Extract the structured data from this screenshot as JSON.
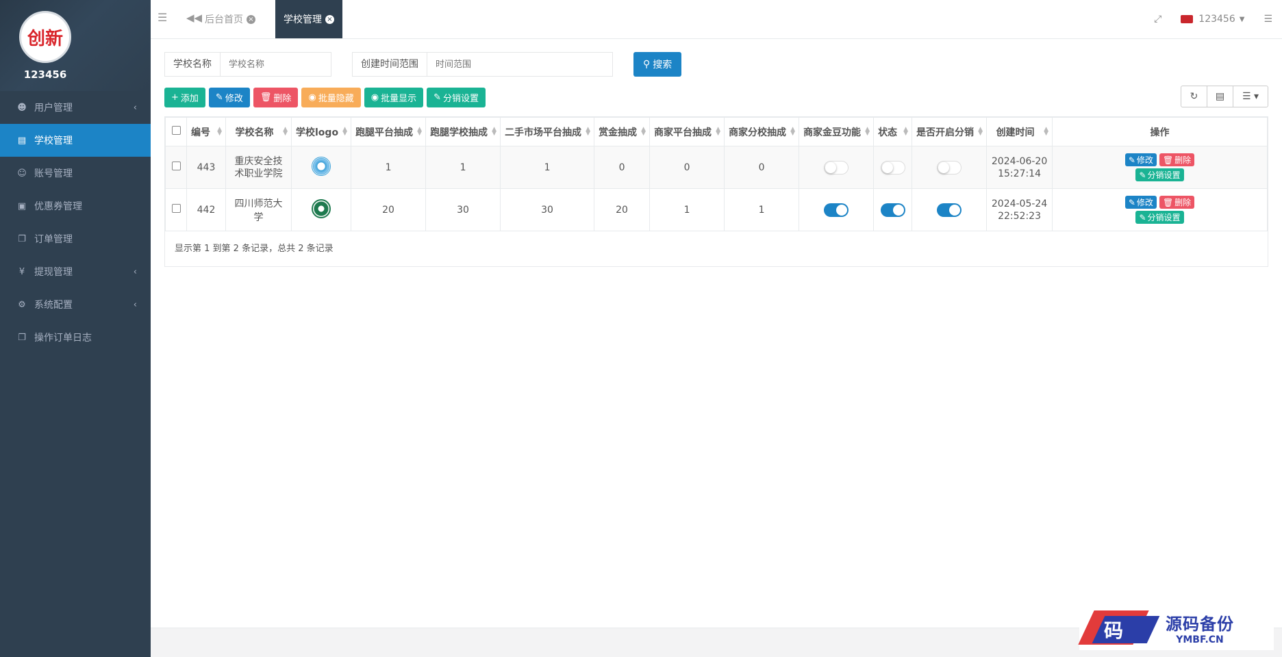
{
  "profile": {
    "name": "123456",
    "logo_text": "创新"
  },
  "sidebar": {
    "items": [
      {
        "label": "用户管理",
        "icon": "user-icon",
        "has_arrow": true,
        "active": false
      },
      {
        "label": "学校管理",
        "icon": "file-icon",
        "has_arrow": false,
        "active": true
      },
      {
        "label": "账号管理",
        "icon": "users-icon",
        "has_arrow": false,
        "active": false
      },
      {
        "label": "优惠券管理",
        "icon": "money-icon",
        "has_arrow": false,
        "active": false
      },
      {
        "label": "订单管理",
        "icon": "copy-icon",
        "has_arrow": false,
        "active": false
      },
      {
        "label": "提现管理",
        "icon": "yen-icon",
        "has_arrow": true,
        "active": false
      },
      {
        "label": "系统配置",
        "icon": "gear-icon",
        "has_arrow": true,
        "active": false
      },
      {
        "label": "操作订单日志",
        "icon": "copy-icon",
        "has_arrow": false,
        "active": false
      }
    ]
  },
  "topbar": {
    "tabs": [
      {
        "label": "后台首页",
        "active": false
      },
      {
        "label": "学校管理",
        "active": true
      }
    ],
    "user": "123456"
  },
  "search": {
    "school_label": "学校名称",
    "school_placeholder": "学校名称",
    "time_label": "创建时间范围",
    "time_placeholder": "时间范围",
    "button": "搜索"
  },
  "toolbar": {
    "add": "添加",
    "edit": "修改",
    "delete": "删除",
    "batch_hide": "批量隐藏",
    "batch_show": "批量显示",
    "distribution": "分销设置"
  },
  "table": {
    "headers": [
      "编号",
      "学校名称",
      "学校logo",
      "跑腿平台抽成",
      "跑腿学校抽成",
      "二手市场平台抽成",
      "赏金抽成",
      "商家平台抽成",
      "商家分校抽成",
      "商家金豆功能",
      "状态",
      "是否开启分销",
      "创建时间",
      "操作"
    ],
    "rows": [
      {
        "id": "443",
        "name": "重庆安全技术职业学院",
        "logo": "school-logo-icon",
        "errand_platform": "1",
        "errand_school": "1",
        "market_platform": "1",
        "bounty": "0",
        "merchant_platform": "0",
        "merchant_school": "0",
        "bean": false,
        "status": false,
        "distribution": false,
        "date": "2024-06-20",
        "time": "15:27:14"
      },
      {
        "id": "442",
        "name": "四川师范大学",
        "logo": "school-logo-icon",
        "errand_platform": "20",
        "errand_school": "30",
        "market_platform": "30",
        "bounty": "20",
        "merchant_platform": "1",
        "merchant_school": "1",
        "bean": true,
        "status": true,
        "distribution": true,
        "date": "2024-05-24",
        "time": "22:52:23"
      }
    ],
    "row_actions": {
      "edit": "修改",
      "delete": "删除",
      "distribution": "分销设置"
    },
    "summary": "显示第 1 到第 2 条记录，总共 2 条记录"
  },
  "watermark": {
    "glyph": "码",
    "cn": "源码备份",
    "en": "YMBF.CN"
  },
  "colors": {
    "sidebar": "#2f4050",
    "primary": "#1c84c6",
    "success": "#1ab394",
    "danger": "#ed5565",
    "warning": "#f8ac59"
  }
}
